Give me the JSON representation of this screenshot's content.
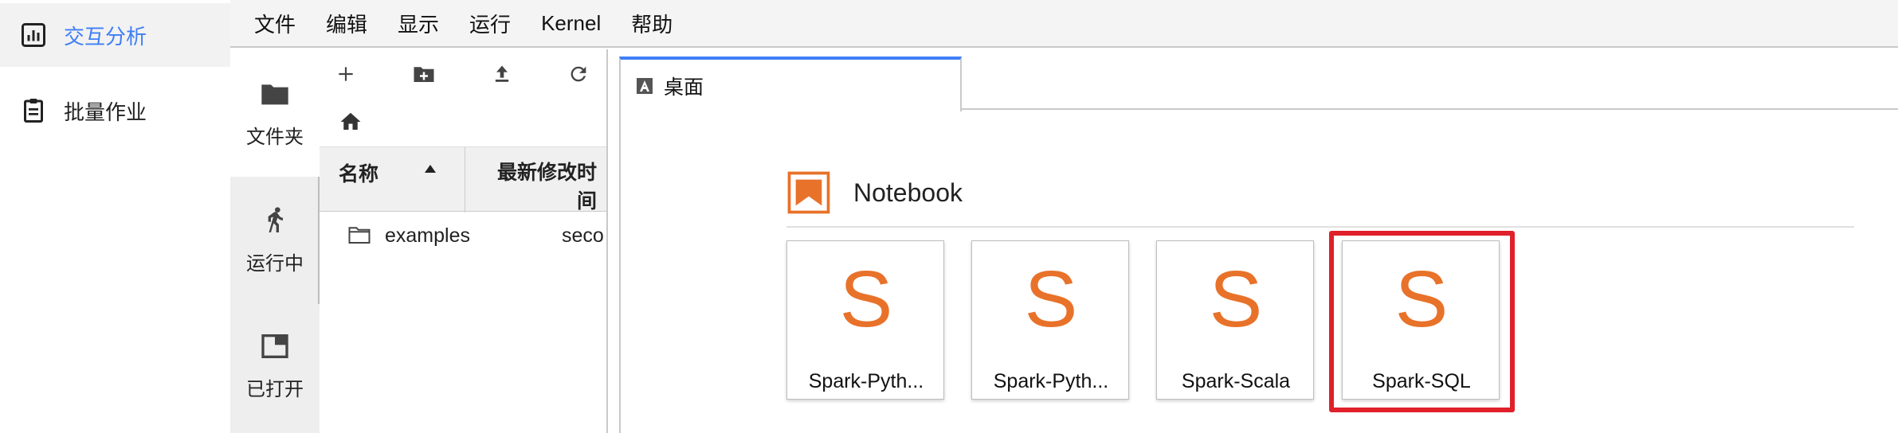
{
  "app_nav": {
    "items": [
      {
        "label": "交互分析",
        "icon": "chart-icon",
        "active": true
      },
      {
        "label": "批量作业",
        "icon": "clipboard-icon",
        "active": false
      }
    ]
  },
  "menubar": {
    "items": [
      "文件",
      "编辑",
      "显示",
      "运行",
      "Kernel",
      "帮助"
    ]
  },
  "side_tabs": [
    {
      "label": "文件夹",
      "icon": "folder-icon",
      "active": true
    },
    {
      "label": "运行中",
      "icon": "running-icon",
      "active": false
    },
    {
      "label": "已打开",
      "icon": "tab-window-icon",
      "active": false
    }
  ],
  "file_browser": {
    "toolbar": [
      "new-file-icon",
      "new-folder-icon",
      "upload-icon",
      "refresh-icon"
    ],
    "columns": {
      "name": "名称",
      "modified": "最新修改时间"
    },
    "rows": [
      {
        "name": "examples",
        "modified": "seco"
      }
    ]
  },
  "main": {
    "tab": {
      "label": "桌面",
      "icon": "launcher-icon"
    },
    "section": {
      "title": "Notebook",
      "icon": "notebook-bookmark-icon"
    },
    "kernels": [
      {
        "letter": "S",
        "label": "Spark-Pyth..."
      },
      {
        "letter": "S",
        "label": "Spark-Pyth..."
      },
      {
        "letter": "S",
        "label": "Spark-Scala"
      },
      {
        "letter": "S",
        "label": "Spark-SQL",
        "highlighted": true
      }
    ]
  },
  "colors": {
    "accent": "#3f7ef6",
    "kernel_orange": "#e8722a",
    "highlight_red": "#e0202a"
  }
}
